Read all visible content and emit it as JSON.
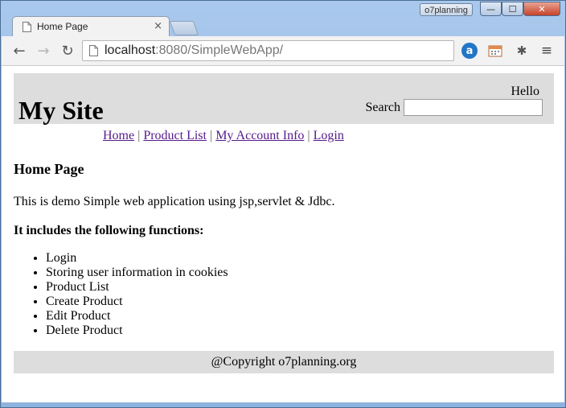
{
  "window": {
    "profile_label": "o7planning",
    "minimize_glyph": "—",
    "maximize_glyph": "☐",
    "close_glyph": "✕"
  },
  "tab": {
    "title": "Home Page",
    "close_glyph": "×"
  },
  "toolbar": {
    "back_glyph": "←",
    "forward_glyph": "→",
    "reload_glyph": "↻",
    "url_host": "localhost",
    "url_rest": ":8080/SimpleWebApp/",
    "ext_a_label": "a",
    "bug_glyph": "✱",
    "menu_glyph": "≡"
  },
  "page": {
    "site_title": "My Site",
    "hello": "Hello",
    "search_label": "Search",
    "search_value": "",
    "menu": [
      {
        "label": "Home"
      },
      {
        "label": "Product List"
      },
      {
        "label": "My Account Info"
      },
      {
        "label": "Login"
      }
    ],
    "menu_separator": "|",
    "heading": "Home Page",
    "intro": "This is demo Simple web application using jsp,servlet & Jdbc.",
    "functions_heading": "It includes the following functions:",
    "functions": [
      "Login",
      "Storing user information in cookies",
      "Product List",
      "Create Product",
      "Edit Product",
      "Delete Product"
    ],
    "footer": "@Copyright o7planning.org"
  },
  "colors": {
    "header_bg": "#dddddd",
    "link_visited": "#551a8b",
    "chrome_frame": "#a9c8ec"
  }
}
